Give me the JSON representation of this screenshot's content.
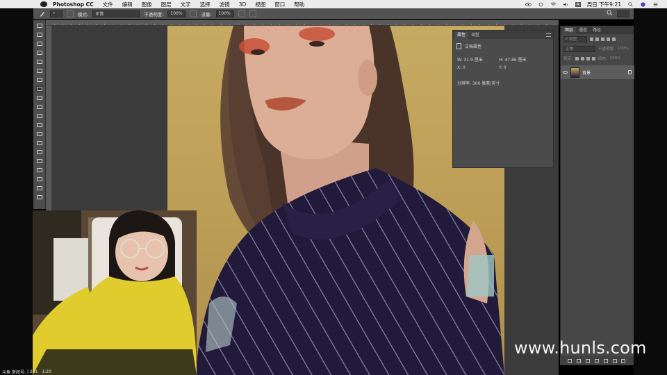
{
  "menubar": {
    "app_name": "Photoshop CC",
    "items": [
      "文件",
      "编辑",
      "图像",
      "图层",
      "文字",
      "选择",
      "滤镜",
      "3D",
      "视图",
      "窗口",
      "帮助"
    ],
    "input_label": "A",
    "clock": "周日 下午9:21"
  },
  "optbar": {
    "mode_label": "模式:",
    "mode_value": "正常",
    "opacity_label": "不透明度:",
    "opacity_value": "100%",
    "flow_label": "流量:",
    "flow_value": "100%"
  },
  "tools": [
    "move",
    "marquee",
    "lasso",
    "quick-select",
    "crop",
    "eyedropper",
    "healing",
    "brush",
    "clone-stamp",
    "history-brush",
    "eraser",
    "gradient",
    "blur",
    "dodge",
    "pen",
    "type",
    "path-select",
    "shape",
    "hand",
    "zoom"
  ],
  "properties": {
    "tab_properties": "属性",
    "tab_adjustments": "调整",
    "doc_title": "文档属性",
    "width": "W: 31.9 厘米",
    "height": "H: 47.86 厘米",
    "x": "X: 0",
    "y": "Y: 0",
    "resolution": "分辨率: 300 像素/英寸"
  },
  "layers": {
    "tab_layers": "图层",
    "tab_channels": "通道",
    "tab_paths": "路径",
    "filter_kind": "P 类型",
    "blend_mode": "正常",
    "opacity_label": "不透明度:",
    "opacity_value": "100%",
    "lock_label": "锁定:",
    "fill_label": "填充:",
    "fill_value": "100%",
    "layer_name": "背景"
  },
  "stream": {
    "platform": "斗鱼 房间号:",
    "date": "| 201",
    "time": "1:20"
  },
  "watermark": "www.hunls.com",
  "colors": {
    "background_yellow": "#c4a65f",
    "garment": "#211838",
    "sweater": "#e0cc2c",
    "panel": "#4b4b4b"
  }
}
